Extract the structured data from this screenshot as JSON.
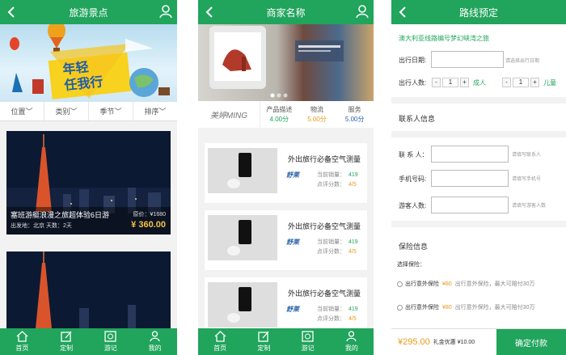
{
  "travel": {
    "title": "旅游景点",
    "filters": [
      "位置",
      "类别",
      "季节",
      "排序"
    ],
    "cards": [
      {
        "title": "塞班游艇浪漫之旅超体验6日游",
        "sub": "出发地：北京 天数：2天",
        "orig": "原价：¥1680",
        "price": "¥ 360.00"
      }
    ]
  },
  "shop": {
    "title": "商家名称",
    "logo": "美婷MING",
    "scores": [
      {
        "label": "产品描述",
        "value": "4.00分"
      },
      {
        "label": "物流",
        "value": "5.00分"
      },
      {
        "label": "服务",
        "value": "5.00分"
      }
    ],
    "products": [
      {
        "name": "外出旅行必备空气测量",
        "brand": "舒莱",
        "sales_label": "当前销量：",
        "sales": "419",
        "score_label": "点评分数：",
        "score": "4/5"
      },
      {
        "name": "外出旅行必备空气测量",
        "brand": "舒莱",
        "sales_label": "当前销量：",
        "sales": "419",
        "score_label": "点评分数：",
        "score": "4/5"
      },
      {
        "name": "外出旅行必备空气测量",
        "brand": "舒莱",
        "sales_label": "当前销量：",
        "sales": "419",
        "score_label": "点评分数：",
        "score": "4/5"
      }
    ]
  },
  "tabs": [
    "首页",
    "定制",
    "游记",
    "我的"
  ],
  "booking": {
    "title": "路线预定",
    "route": "澳大利亚线路编号梦幻峡湾之旅",
    "date_label": "出行日期:",
    "date_placeholder": "请选择出行日期",
    "people_label": "出行人数:",
    "adult_count": "1",
    "adult_label": "成人",
    "child_count": "1",
    "child_label": "儿童",
    "contact_section": "联系人信息",
    "contact_label": "联 系 人：",
    "contact_placeholder": "请填写联系人",
    "phone_label": "手机号码:",
    "phone_placeholder": "请填写手机号",
    "guest_label": "游客人数:",
    "guest_placeholder": "请填写游客人数",
    "insurance_section": "保险信息",
    "insurance_choose": "选择保险：",
    "insurance": [
      {
        "name": "出行意外保险",
        "price": "¥80",
        "desc": "出行意外保险，最大可赔付30万"
      },
      {
        "name": "出行意外保险",
        "price": "¥80",
        "desc": "出行意外保险，最大可赔付30万"
      }
    ],
    "total": "¥295.00",
    "gift": "礼金优惠 ¥10.00",
    "pay": "确定付款"
  },
  "colors": {
    "brand": "#21a45c",
    "price": "#e79a1b",
    "link": "#2a63a8"
  }
}
